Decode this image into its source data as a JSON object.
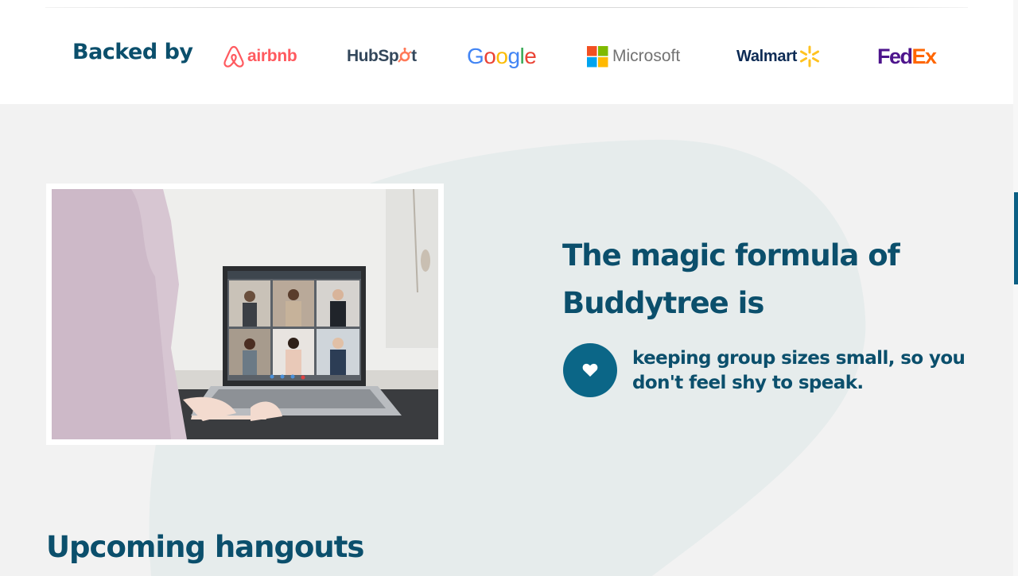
{
  "backed_by": {
    "label": "Backed by",
    "logos": {
      "airbnb": "airbnb",
      "hubspot_a": "HubSp",
      "hubspot_b": "t",
      "google": [
        "G",
        "o",
        "o",
        "g",
        "l",
        "e"
      ],
      "microsoft": "Microsoft",
      "walmart": "Walmart",
      "fedex_a": "Fed",
      "fedex_b": "Ex"
    }
  },
  "feature": {
    "headline": "The magic formula of Buddytree is",
    "icon": "heart-icon",
    "text": "keeping group sizes small, so you don't feel shy to speak."
  },
  "upcoming": {
    "title": "Upcoming hangouts"
  },
  "colors": {
    "brand": "#0b4f6c",
    "accent": "#0b6687",
    "background": "#f2f2f2"
  }
}
